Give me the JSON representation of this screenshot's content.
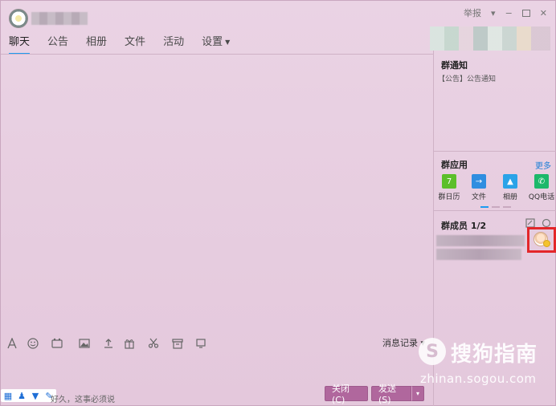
{
  "window": {
    "controls": {
      "report": "举报",
      "menu_caret": "▾",
      "minimize": "−",
      "close": "✕"
    }
  },
  "nav": {
    "tabs": [
      {
        "label": "聊天",
        "active": true
      },
      {
        "label": "公告"
      },
      {
        "label": "相册"
      },
      {
        "label": "文件"
      },
      {
        "label": "活动"
      },
      {
        "label": "设置"
      }
    ]
  },
  "toolbar": {
    "history_label": "消息记录",
    "history_caret": "▾"
  },
  "input": {
    "tip_text": "好久，这事必须说"
  },
  "buttons": {
    "close_label": "关闭(C)",
    "send_label": "发送(S)",
    "send_dropdown": "▾"
  },
  "right_panel": {
    "notice": {
      "title": "群通知",
      "text": "【公告】公告通知"
    },
    "apps": {
      "title": "群应用",
      "more": "更多",
      "items": [
        {
          "label": "群日历",
          "color": "#5cbf2a",
          "icon": "calendar-icon",
          "glyph": "7"
        },
        {
          "label": "文件",
          "color": "#2f8ee0",
          "icon": "folder-icon",
          "glyph": "→"
        },
        {
          "label": "相册",
          "color": "#2aa3e8",
          "icon": "photo-icon",
          "glyph": "▲"
        },
        {
          "label": "QQ电话",
          "color": "#1cb86a",
          "icon": "phone-icon",
          "glyph": "✆"
        }
      ]
    },
    "members": {
      "title": "群成员 1/2"
    }
  },
  "watermark": {
    "logo": "S",
    "brand": "搜狗指南",
    "url": "zhinan.sogou.com"
  },
  "colors": {
    "accent": "#1d9bf0",
    "button": "#b0679d",
    "highlight": "#e3262a"
  }
}
